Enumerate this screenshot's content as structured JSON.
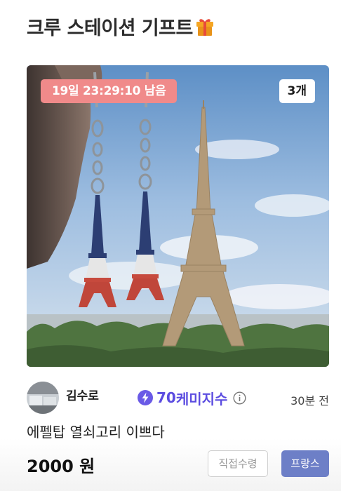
{
  "header": {
    "title": "크루 스테이션 기프트",
    "icon": "gift-icon"
  },
  "item": {
    "image": "eiffel-tower-keychains-photo",
    "timer": "19일 23:29:10 남음",
    "quantity": "3개",
    "name": "에펠탑 열쇠고리 이쁘다",
    "price": "2000 원"
  },
  "seller": {
    "name": "김수로",
    "chem_icon": "lightning-bolt-icon",
    "chem_value": "70",
    "chem_label": "케미지수",
    "info_icon": "info-icon",
    "posted": "30분 전"
  },
  "actions": {
    "pickup_label": "직접수령",
    "country_label": "프랑스"
  },
  "colors": {
    "timer_badge": "#f08a8a",
    "chem_accent": "#5b4ce0",
    "country_button": "#6d7fc7"
  }
}
